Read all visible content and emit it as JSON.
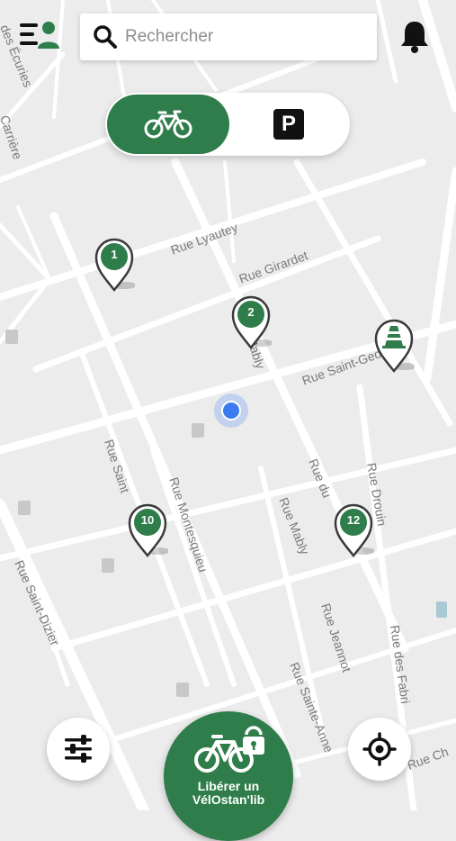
{
  "header": {
    "menu_icon": "menu-user-icon",
    "search": {
      "placeholder": "Rechercher",
      "value": ""
    },
    "notification_icon": "bell-icon"
  },
  "mode_toggle": {
    "options": [
      {
        "id": "bikes",
        "icon": "bicycle-icon",
        "selected": true
      },
      {
        "id": "parking",
        "icon": "parking-icon",
        "text": "P",
        "selected": false
      }
    ]
  },
  "map": {
    "streets": [
      "Rue Lyautey",
      "Rue Girardet",
      "Rue Saint-Georges",
      "Rue Saint",
      "Rue Montesquieu",
      "Rue Mably",
      "Rue du",
      "Rue Drouin",
      "Rue Saint-Dizier",
      "Rue Jeannot",
      "Rue Sainte-Anne",
      "Rue des Fabri",
      "Rue Ch",
      "Carrière",
      "des Écuries",
      "Mably"
    ],
    "markers": [
      {
        "type": "station",
        "count": "1"
      },
      {
        "type": "station",
        "count": "2"
      },
      {
        "type": "station",
        "count": "10"
      },
      {
        "type": "station",
        "count": "12"
      },
      {
        "type": "works",
        "icon": "traffic-cone-icon"
      }
    ],
    "user_location": "blue-dot"
  },
  "bottom": {
    "filters_icon": "sliders-icon",
    "locate_icon": "crosshair-icon",
    "release_button": {
      "line1": "Libérer un",
      "line2": "VélOstan'lib",
      "icon": "bike-lock-icon"
    }
  },
  "colors": {
    "brand_green": "#2e7d4a",
    "user_blue": "#3d7cf0",
    "map_bg": "#ececec"
  }
}
